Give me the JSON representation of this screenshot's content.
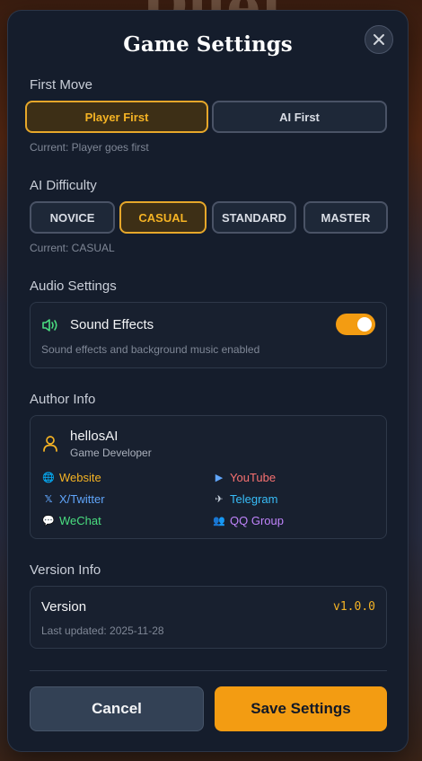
{
  "background": {
    "title": "Duel"
  },
  "modal": {
    "title": "Game Settings"
  },
  "first_move": {
    "label": "First Move",
    "options": [
      "Player First",
      "AI First"
    ],
    "selected": "Player First",
    "current_text": "Current: Player goes first"
  },
  "ai_difficulty": {
    "label": "AI Difficulty",
    "options": [
      "NOVICE",
      "CASUAL",
      "STANDARD",
      "MASTER"
    ],
    "selected": "CASUAL",
    "current_text": "Current: CASUAL"
  },
  "audio": {
    "label": "Audio Settings",
    "sound_effects_label": "Sound Effects",
    "sound_effects_enabled": true,
    "description": "Sound effects and background music enabled"
  },
  "author": {
    "label": "Author Info",
    "name": "hellosAI",
    "role": "Game Developer",
    "links": [
      {
        "label": "Website",
        "icon": "globe-icon",
        "color": "#f5b324"
      },
      {
        "label": "YouTube",
        "icon": "youtube-icon",
        "color": "#f87171"
      },
      {
        "label": "X/Twitter",
        "icon": "x-twitter-icon",
        "color": "#60a5fa"
      },
      {
        "label": "Telegram",
        "icon": "telegram-icon",
        "color": "#38bdf8"
      },
      {
        "label": "WeChat",
        "icon": "wechat-icon",
        "color": "#4ade80"
      },
      {
        "label": "QQ Group",
        "icon": "qq-group-icon",
        "color": "#c084fc"
      }
    ]
  },
  "version": {
    "label": "Version Info",
    "title": "Version",
    "number": "v1.0.0",
    "last_updated": "Last updated: 2025-11-28"
  },
  "footer": {
    "cancel_label": "Cancel",
    "save_label": "Save Settings"
  },
  "colors": {
    "accent": "#f39c12",
    "panel_bg": "#151d2c"
  }
}
